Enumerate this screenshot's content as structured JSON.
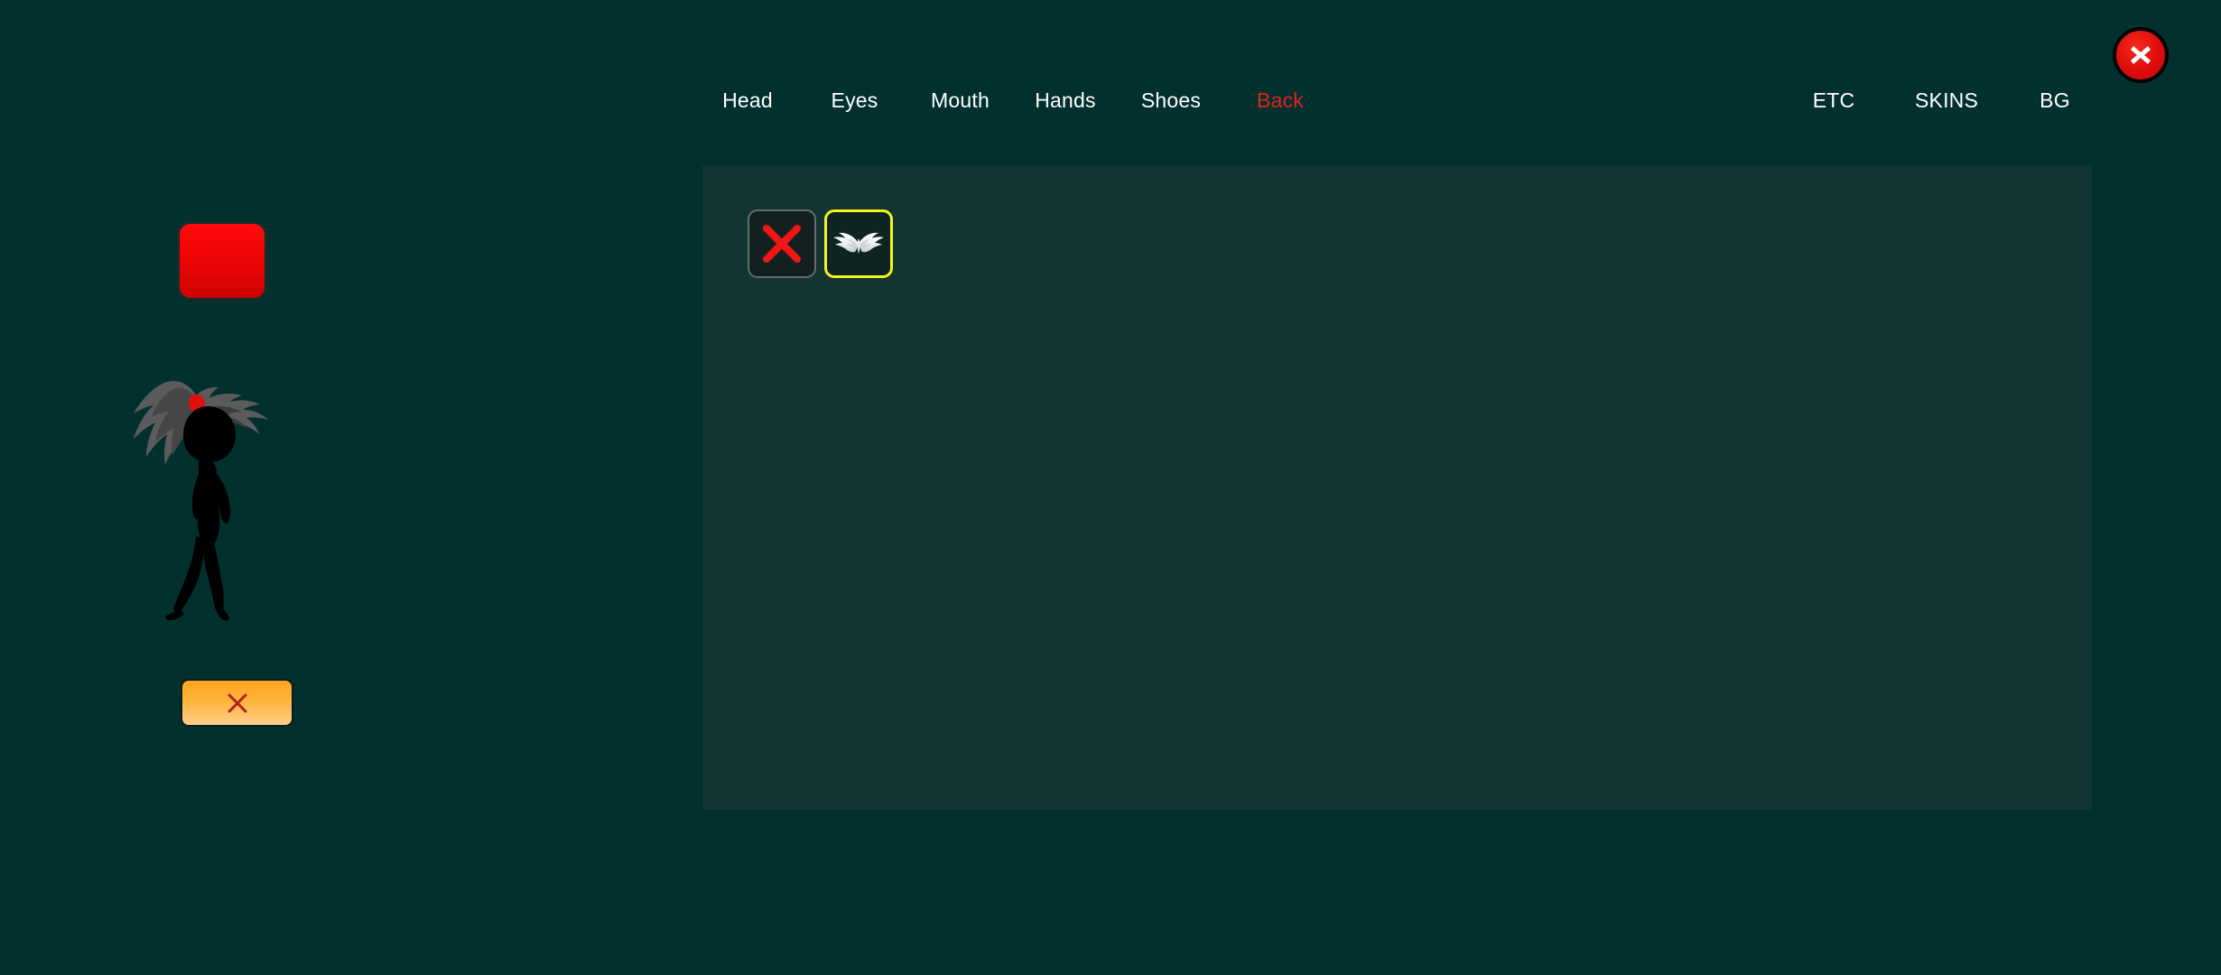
{
  "app": {
    "background_color": "#02302f",
    "panel_color": "#123432",
    "accent_active_color": "#e32219",
    "selection_border_color": "#f2f518"
  },
  "nav": {
    "left_tabs": [
      {
        "label": "Head",
        "active": false
      },
      {
        "label": "Eyes",
        "active": false
      },
      {
        "label": "Mouth",
        "active": false
      },
      {
        "label": "Hands",
        "active": false
      },
      {
        "label": "Shoes",
        "active": false
      },
      {
        "label": "Back",
        "active": true
      }
    ],
    "right_tabs": [
      {
        "label": "ETC",
        "active": false
      },
      {
        "label": "SKINS",
        "active": false
      },
      {
        "label": "BG",
        "active": false
      }
    ]
  },
  "close_button": {
    "icon": "close-x-icon",
    "label": "X",
    "color": "#e00d0d"
  },
  "items_panel": {
    "slots": [
      {
        "icon": "red-x-none-icon",
        "name": "none",
        "selected": false
      },
      {
        "icon": "white-wings-icon",
        "name": "wings",
        "selected": true
      }
    ]
  },
  "preview": {
    "color_swatch": {
      "icon": "color-swatch",
      "color": "#f20505"
    },
    "character": {
      "icon": "stickman-avatar",
      "body_color": "#000000",
      "hair_color": "#5a5a5a",
      "eye_color": "#e01010",
      "hair_tie_color": "#e01010"
    },
    "action_button": {
      "icon": "red-x-icon",
      "color": "#ffb43a"
    }
  }
}
